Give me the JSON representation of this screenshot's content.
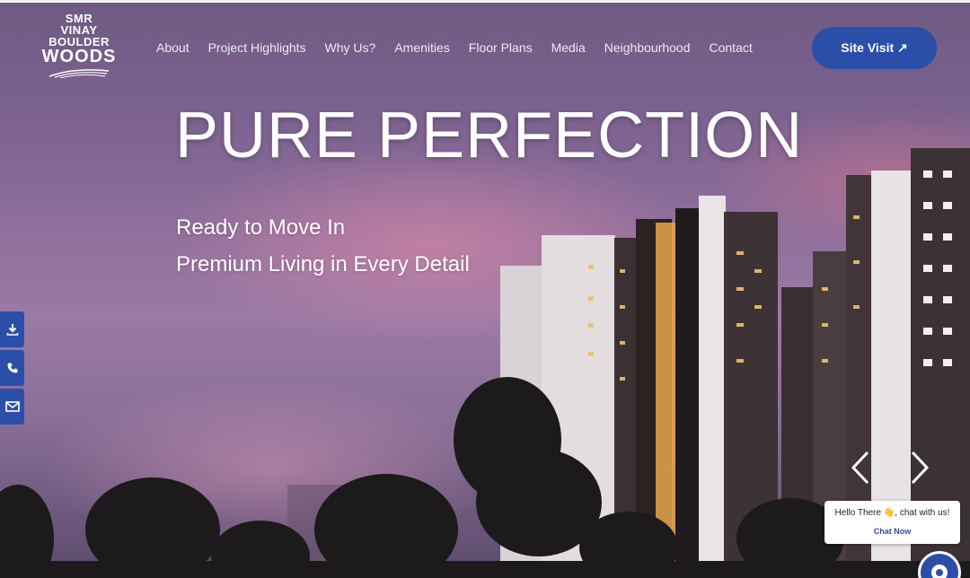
{
  "brand": {
    "line1": "SMR",
    "line2": "VINAY",
    "line3": "BOULDER",
    "line4": "WOODS"
  },
  "nav": {
    "items": [
      "About",
      "Project Highlights",
      "Why Us?",
      "Amenities",
      "Floor Plans",
      "Media",
      "Neighbourhood",
      "Contact"
    ]
  },
  "cta": {
    "label": "Site Visit ↗"
  },
  "hero": {
    "headline": "PURE PERFECTION",
    "sub1": "Ready to Move In",
    "sub2": "Premium Living in Every Detail"
  },
  "side_actions": [
    "download-icon",
    "phone-icon",
    "mail-icon"
  ],
  "slider": {
    "prev": "chevron-left-icon",
    "next": "chevron-right-icon"
  },
  "chat": {
    "greeting": "Hello There 👋, chat with us!",
    "action": "Chat Now"
  },
  "colors": {
    "accent": "#2b4fa8",
    "text": "#ffffff"
  }
}
